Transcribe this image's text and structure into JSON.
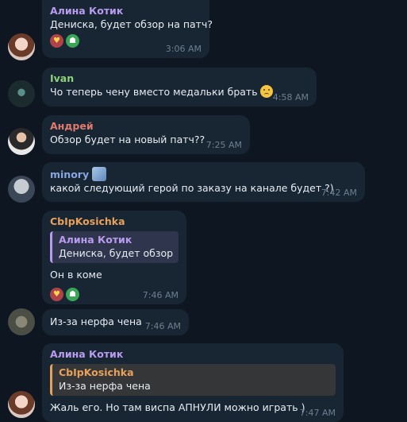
{
  "messages": [
    {
      "sender": "Алина Котик",
      "sender_color": "#b99cf0",
      "text": "Дениска, будет обзор на патч?",
      "time": "3:06 AM",
      "reactions": [
        "heart-eyes-icon",
        "ghost-icon"
      ],
      "avatar": "avatar-alina-icon"
    },
    {
      "sender": "Ivan",
      "sender_color": "#8fd17c",
      "text": "Чо теперь чену вместо медальки брать",
      "time": "4:58 AM",
      "avatar": "avatar-ivan-icon",
      "trailing_emoji": "sad-face-icon"
    },
    {
      "sender": "Андрей",
      "sender_color": "#e07a6f",
      "text": "Обзор будет на новый патч??",
      "time": "7:25 AM",
      "avatar": "avatar-andrey-icon"
    },
    {
      "sender": "minory",
      "sender_color": "#8aa6e0",
      "text": "какой следующий герой по заказу на канале будет ?)",
      "time": "7:42 AM",
      "avatar": "avatar-minory-icon",
      "sender_badge": "anime-sticker-icon"
    },
    {
      "sender": "CbIpKosichka",
      "sender_color": "#e8a15a",
      "reply": {
        "name": "Алина Котик",
        "text": "Дениска, будет обзор..."
      },
      "reply_color": "#b99cf0",
      "text": "Он в коме",
      "time": "7:46 AM",
      "reactions": [
        "heart-eyes-icon",
        "ghost-icon"
      ]
    },
    {
      "text": "Из-за нерфа чена",
      "time": "7:46 AM",
      "avatar": "avatar-cbip-icon"
    },
    {
      "sender": "Алина Котик",
      "sender_color": "#b99cf0",
      "reply": {
        "name": "CbIpKosichka",
        "text": "Из-за нерфа чена"
      },
      "reply_color": "#e8a15a",
      "text": "Жаль его. Но там виспа АПНУЛИ можно играть )",
      "time": "7:47 AM",
      "avatar": "avatar-alina-icon"
    }
  ]
}
